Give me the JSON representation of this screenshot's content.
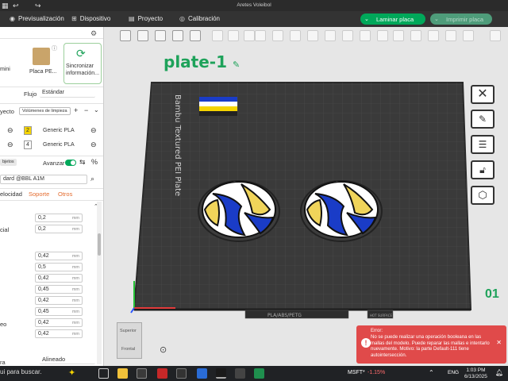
{
  "window": {
    "title": "Aretes Voleibol"
  },
  "menu": {
    "tabs": [
      {
        "label": "Previsualización",
        "icon": "eye-icon"
      },
      {
        "label": "Dispositivo",
        "icon": "device-icon"
      },
      {
        "label": "Proyecto",
        "icon": "folder-icon"
      },
      {
        "label": "Calibración",
        "icon": "gauge-icon"
      }
    ],
    "slice_button": "Laminar placa",
    "print_button": "Imprimir placa"
  },
  "left": {
    "printer_tile": "mini",
    "plate_tile": "Placa PE...",
    "sync_tile": "Sincronizar información...",
    "flow_label": "Flujo",
    "flow_value": "Estándar",
    "project_label": "yecto",
    "cleaning_volume_btn": "Volúmenes de limpieza",
    "filaments": [
      {
        "num": "2",
        "name": "Generic PLA",
        "color": "#f5d400"
      },
      {
        "num": "4",
        "name": "Generic PLA",
        "color": "#ffffff"
      }
    ],
    "objects_tab": "bjetos",
    "advanced_label": "Avanzar",
    "process_preset": "dard @BBL A1M",
    "tabs": [
      "elocidad",
      "Soporte",
      "Otros"
    ],
    "fields_a": [
      {
        "label": "",
        "value": "0,2",
        "unit": "mm"
      },
      {
        "label": "cial",
        "value": "0,2",
        "unit": "mm"
      }
    ],
    "fields_b": [
      {
        "label": "",
        "value": "0,42",
        "unit": "mm"
      },
      {
        "label": "",
        "value": "0,5",
        "unit": "mm"
      },
      {
        "label": "",
        "value": "0,42",
        "unit": "mm"
      },
      {
        "label": "",
        "value": "0,45",
        "unit": "mm"
      },
      {
        "label": "",
        "value": "0,42",
        "unit": "mm"
      },
      {
        "label": "",
        "value": "0,45",
        "unit": "mm"
      },
      {
        "label": "eo",
        "value": "0,42",
        "unit": "mm"
      },
      {
        "label": "",
        "value": "0,42",
        "unit": "mm"
      }
    ],
    "seam_label": "ra",
    "seam_value": "Alineado"
  },
  "viewport": {
    "plate_name": "plate-1",
    "bed_label": "Bambu Textured PEI Plate",
    "bed_strip_text": "PLA/ABS/PETG",
    "bed_tag": "HOT SURFACE",
    "plate_number": "01",
    "view_cube_top": "Superior",
    "view_cube_front": "Frontal",
    "flag_colors": [
      "#1a3cc7",
      "#ffffff",
      "#f5d400",
      "#222222"
    ]
  },
  "error": {
    "title": "Error:",
    "message": "No se puede realizar una operación booleana en las mallas del modelo. Puede reparar las mallas e intentarlo nuevamente. Motivo: la parte Default-111 tiene autointersección."
  },
  "taskbar": {
    "search": "ui para buscar.",
    "ticker": "MSFT*",
    "change": "-1.15%",
    "lang": "ENG",
    "time": "1:03 PM",
    "date": "6/13/2025"
  },
  "colors": {
    "accent": "#00a85a",
    "ball_blue": "#1a3cc7",
    "ball_yellow": "#f0d45a"
  }
}
